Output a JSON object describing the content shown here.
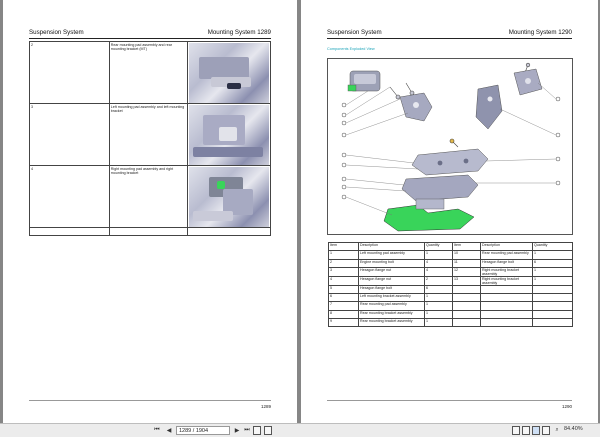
{
  "page_left": {
    "header_left": "Suspension System",
    "header_right": "Mounting System  1289",
    "footer_page": "1289",
    "rows": [
      {
        "item": "2",
        "description": "Rear mounting pad assembly and rear mounting bracket (MT)"
      },
      {
        "item": "3",
        "description": "Left mounting pad assembly and left mounting bracket"
      },
      {
        "item": "4",
        "description": "Right mounting pad assembly and right mounting bracket"
      }
    ]
  },
  "page_right": {
    "header_left": "Suspension System",
    "header_right": "Mounting System  1290",
    "subtitle": "Components Exploded View",
    "footer_page": "1290",
    "table_headers": [
      "Item",
      "Description",
      "Quantity",
      "Item",
      "Description",
      "Quantity"
    ],
    "rows": [
      [
        "1",
        "Left mounting pad assembly",
        "1",
        "10",
        "Rear mounting pad assembly",
        "1"
      ],
      [
        "2",
        "Engine mounting bolt",
        "4",
        "11",
        "Hexagon flange bolt",
        "6"
      ],
      [
        "3",
        "Hexagon flange nut",
        "4",
        "12",
        "Right mounting bracket assembly",
        "1"
      ],
      [
        "4",
        "Hexagon flange nut",
        "2",
        "13",
        "Right mounting bracket assembly",
        "1"
      ],
      [
        "5",
        "Hexagon flange bolt",
        "6",
        "",
        "",
        ""
      ],
      [
        "6",
        "Left mounting bracket assembly",
        "1",
        "",
        "",
        ""
      ],
      [
        "7",
        "Rear mounting pad assembly",
        "1",
        "",
        "",
        ""
      ],
      [
        "8",
        "Rear mounting bracket assembly",
        "1",
        "",
        "",
        ""
      ],
      [
        "9",
        "Rear mounting bracket assembly",
        "1",
        "",
        "",
        ""
      ]
    ]
  },
  "toolbar": {
    "page_value": "1289 / 1904",
    "zoom": "84.40%"
  },
  "colors": {
    "accent": "#1aa3b8",
    "highlight_part": "#39d45a"
  }
}
